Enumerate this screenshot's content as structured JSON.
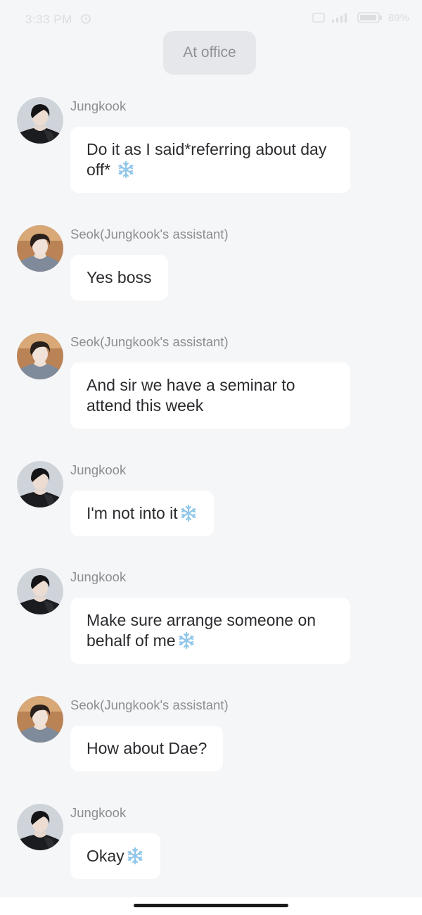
{
  "status_bar": {
    "time": "3:33 PM",
    "battery": "89%"
  },
  "scene": {
    "label": "At office"
  },
  "messages": [
    {
      "sender": "Jungkook",
      "avatar": "jungkook-avatar",
      "text": "Do it as I said*referring about day off* ",
      "emoji": "snowflake-icon"
    },
    {
      "sender": "Seok(Jungkook's assistant)",
      "avatar": "seok-avatar",
      "text": "Yes boss",
      "emoji": ""
    },
    {
      "sender": "Seok(Jungkook's assistant)",
      "avatar": "seok-avatar",
      "text": "And sir we have a seminar to attend this week",
      "emoji": ""
    },
    {
      "sender": "Jungkook",
      "avatar": "jungkook-avatar",
      "text": "I'm not into it",
      "emoji": "snowflake-icon"
    },
    {
      "sender": "Jungkook",
      "avatar": "jungkook-avatar",
      "text": "Make sure arrange someone on behalf of me",
      "emoji": "snowflake-icon"
    },
    {
      "sender": "Seok(Jungkook's assistant)",
      "avatar": "seok-avatar",
      "text": "How about Dae?",
      "emoji": ""
    },
    {
      "sender": "Jungkook",
      "avatar": "jungkook-avatar",
      "text": "Okay",
      "emoji": "snowflake-icon"
    }
  ],
  "colors": {
    "background": "#f5f6f8",
    "bubble": "#ffffff",
    "sender_text": "#8c8e92",
    "message_text": "#2a2b2e",
    "scene_pill": "#e6e7ea",
    "snowflake": "#8fc6ea"
  }
}
